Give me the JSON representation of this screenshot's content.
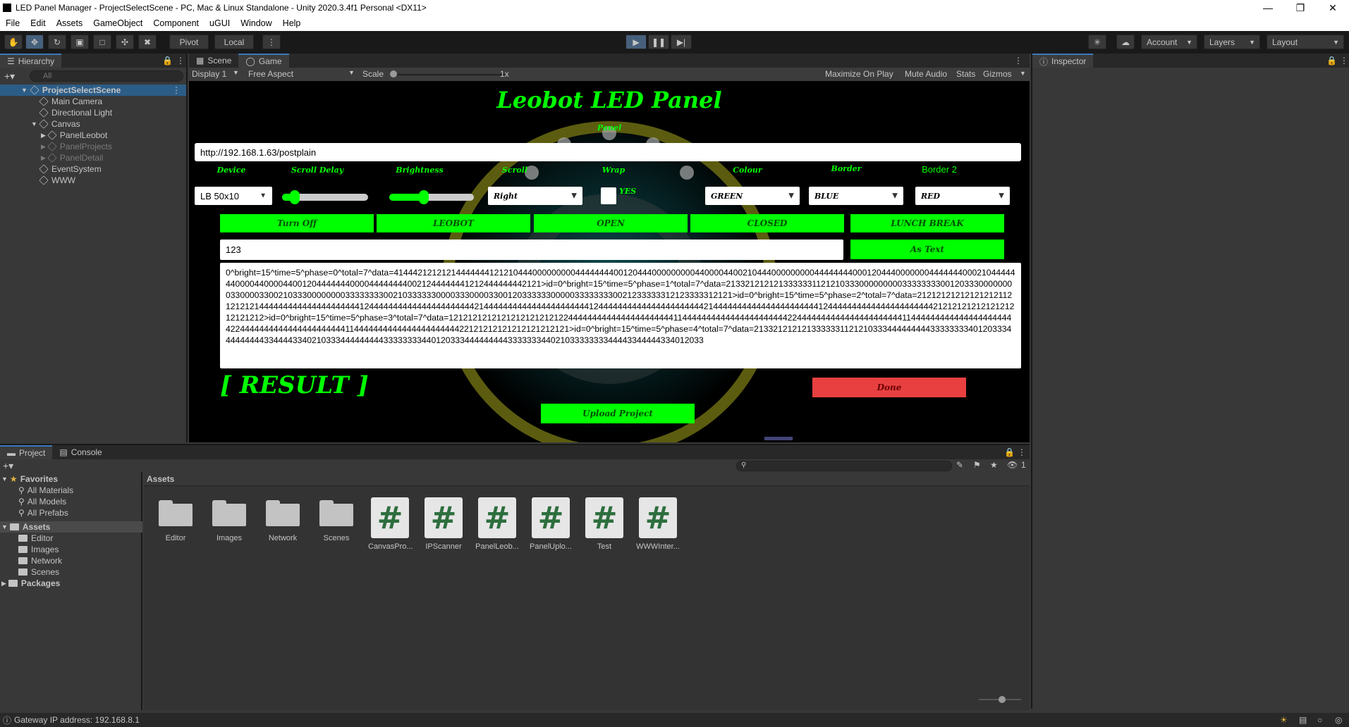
{
  "window": {
    "title": "LED Panel Manager - ProjectSelectScene - PC, Mac & Linux Standalone - Unity 2020.3.4f1 Personal <DX11>"
  },
  "menu": [
    "File",
    "Edit",
    "Assets",
    "GameObject",
    "Component",
    "uGUI",
    "Window",
    "Help"
  ],
  "toolbar": {
    "pivot": "Pivot",
    "local": "Local",
    "account": "Account",
    "layers": "Layers",
    "layout": "Layout"
  },
  "hierarchy": {
    "tab": "Hierarchy",
    "search_placeholder": "All",
    "items": [
      {
        "label": "ProjectSelectScene"
      },
      {
        "label": "Main Camera"
      },
      {
        "label": "Directional Light"
      },
      {
        "label": "Canvas"
      },
      {
        "label": "PanelLeobot"
      },
      {
        "label": "PanelProjects"
      },
      {
        "label": "PanelDetail"
      },
      {
        "label": "EventSystem"
      },
      {
        "label": "WWW"
      }
    ]
  },
  "scene_tabs": {
    "scene": "Scene",
    "game": "Game"
  },
  "game_toolbar": {
    "display": "Display 1",
    "aspect": "Free Aspect",
    "scale_label": "Scale",
    "scale_value": "1x",
    "maximize": "Maximize On Play",
    "mute": "Mute Audio",
    "stats": "Stats",
    "gizmos": "Gizmos"
  },
  "game": {
    "title": "Leobot LED Panel",
    "subtitle": "Panel",
    "url": "http://192.168.1.63/postplain",
    "labels": {
      "device": "Device",
      "scroll_delay": "Scroll Delay",
      "brightness": "Brightness",
      "scroll": "Scroll",
      "wrap": "Wrap",
      "colour": "Colour",
      "border": "Border",
      "border2": "Border 2"
    },
    "device_value": "LB 50x10",
    "scroll_value": "Right",
    "wrap_value": "YES",
    "colour_value": "GREEN",
    "border_value": "BLUE",
    "border2_value": "RED",
    "scroll_delay_level": 0.1,
    "brightness_level": 0.4,
    "buttons": [
      "Turn Off",
      "LEOBOT",
      "OPEN",
      "CLOSED",
      "LUNCH BREAK"
    ],
    "text_input": "123",
    "as_text": "As Text",
    "output": "0^bright=15^time=5^phase=0^total=7^data=4144421212121444444412121044400000000044444444001204440000000004400004400210444000000000444444440001204440000000444444400021044444440000440000440012044444440000444444440021244444441212444444442121>id=0^bright=15^time=5^phase=1^total=7^data=2133212121213333331121210333000000000333333330012033300000000330000330021033300000000333333330021033333300003330000330012033333300000333333330021233333312123333312121>id=0^bright=15^time=5^phase=2^total=7^data=2121212121212121211212121214444444444444444444441244444444444444444444442144444444444444444444441244444444444444444444442144444444444444444444441244444444444444444444442121212121212121212121212>id=0^bright=15^time=5^phase=3^total=7^data=1212121212121212121212122444444444444444444444411444444444444444444444422444444444444444444444411444444444444444444444422444444444444444444444411444444444444444444444422121212121212121212121>id=0^bright=15^time=5^phase=4^total=7^data=2133212121213333331121210333444444444333333334012033344444444433444433402103334444444443333333344012033344444444433333334402103333333344443344444334012033",
    "result": "[ RESULT ]",
    "done": "Done",
    "upload": "Upload Project",
    "colors": {
      "green": "#00ff00",
      "done": "#e84040"
    }
  },
  "inspector": {
    "tab": "Inspector"
  },
  "project": {
    "tab": "Project",
    "console_tab": "Console",
    "favorites": {
      "label": "Favorites",
      "items": [
        "All Materials",
        "All Models",
        "All Prefabs"
      ]
    },
    "tree": {
      "assets": "Assets",
      "children": [
        "Editor",
        "Images",
        "Network",
        "Scenes"
      ],
      "packages": "Packages"
    },
    "breadcrumb": "Assets",
    "hidden_count": "1",
    "assets": [
      {
        "name": "Editor",
        "type": "folder"
      },
      {
        "name": "Images",
        "type": "folder"
      },
      {
        "name": "Network",
        "type": "folder"
      },
      {
        "name": "Scenes",
        "type": "folder"
      },
      {
        "name": "CanvasPro...",
        "type": "script"
      },
      {
        "name": "IPScanner",
        "type": "script"
      },
      {
        "name": "PanelLeob...",
        "type": "script"
      },
      {
        "name": "PanelUplo...",
        "type": "script"
      },
      {
        "name": "Test",
        "type": "script"
      },
      {
        "name": "WWWInter...",
        "type": "script"
      }
    ]
  },
  "status": {
    "text": "Gateway IP address: 192.168.8.1"
  }
}
